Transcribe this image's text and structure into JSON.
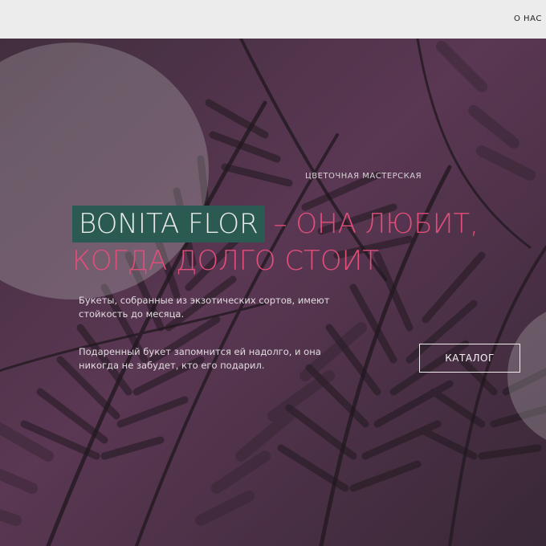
{
  "nav": {
    "about_label": "О НАС"
  },
  "hero": {
    "subtitle": "ЦВЕТОЧНАЯ МАСТЕРСКАЯ",
    "brand": "BONITA FLOR",
    "headline_rest": " – ОНА ЛЮБИТ,",
    "headline_line2": "КОГДА ДОЛГО СТОИТ",
    "description_1": "Букеты, собранные из экзотических сортов, имеют стойкость до месяца.",
    "description_2": "Подаренный букет запомнится ей надолго, и она никогда не забудет, кто его подарил.",
    "catalog_button": "КАТАЛОГ"
  },
  "colors": {
    "accent": "#e24e7a",
    "brand_highlight": "#2a5a52",
    "topbar": "#ececec",
    "background": "#3a2a39"
  }
}
